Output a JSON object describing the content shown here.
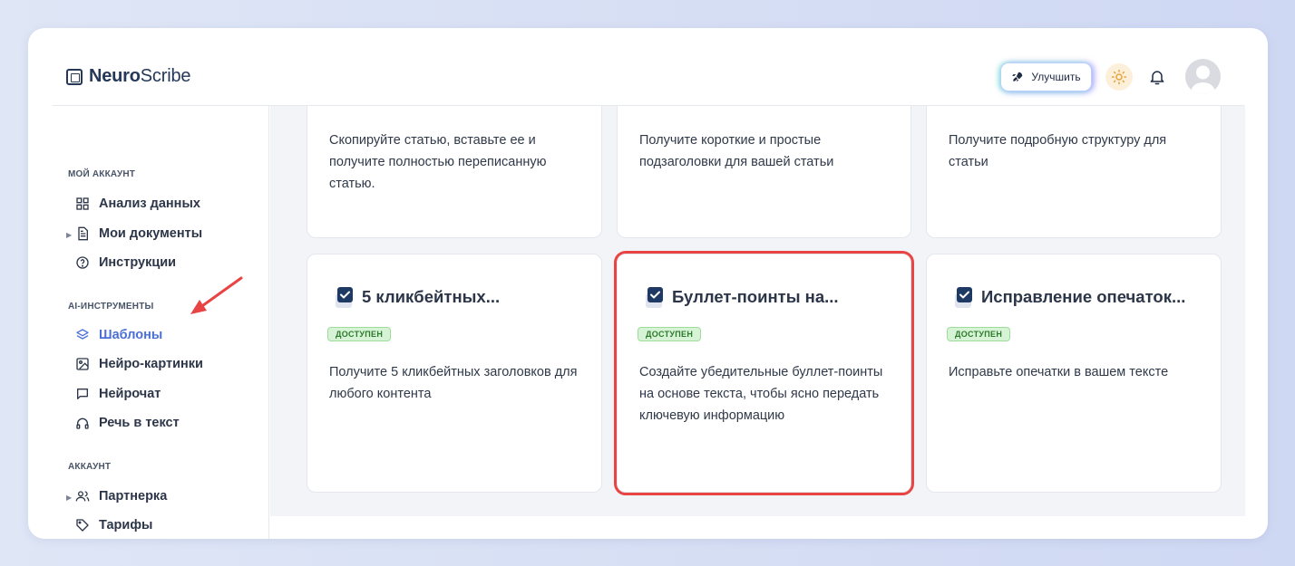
{
  "header": {
    "logo_bold": "Neuro",
    "logo_rest": "Scribe",
    "upgrade_label": "Улучшить"
  },
  "sidebar": {
    "section_account": "МОЙ АККАУНТ",
    "section_ai": "AI-ИНСТРУМЕНТЫ",
    "section_profile": "АККАУНТ",
    "items": [
      {
        "label": "Анализ данных",
        "icon": "grid-icon"
      },
      {
        "label": "Мои документы",
        "icon": "document-icon"
      },
      {
        "label": "Инструкции",
        "icon": "help-circle-icon"
      },
      {
        "label": "Шаблоны",
        "icon": "layers-icon",
        "active": true
      },
      {
        "label": "Нейро-картинки",
        "icon": "image-icon"
      },
      {
        "label": "Нейрочат",
        "icon": "chat-icon"
      },
      {
        "label": "Речь в текст",
        "icon": "headphones-icon"
      },
      {
        "label": "Партнерка",
        "icon": "users-icon"
      },
      {
        "label": "Тарифы",
        "icon": "tag-icon"
      }
    ]
  },
  "cards_top": [
    {
      "desc": "Скопируйте статью, вставьте ее и получите полностью переписанную статью."
    },
    {
      "desc": "Получите короткие и простые подзаголовки для вашей статьи"
    },
    {
      "desc": "Получите подробную структуру для статьи"
    }
  ],
  "cards_bottom": [
    {
      "title": "5 кликбейтных...",
      "badge": "ДОСТУПЕН",
      "desc": "Получите 5 кликбейтных заголовков для любого контента"
    },
    {
      "title": "Буллет-поинты на...",
      "badge": "ДОСТУПЕН",
      "desc": "Создайте убедительные буллет-поинты на основе текста, чтобы ясно передать ключевую информацию"
    },
    {
      "title": "Исправление опечаток...",
      "badge": "ДОСТУПЕН",
      "desc": "Исправьте опечатки в вашем тексте"
    }
  ],
  "colors": {
    "accent": "#4b6fd6",
    "highlight": "#e84444",
    "badge_bg": "#d7f3d6"
  }
}
